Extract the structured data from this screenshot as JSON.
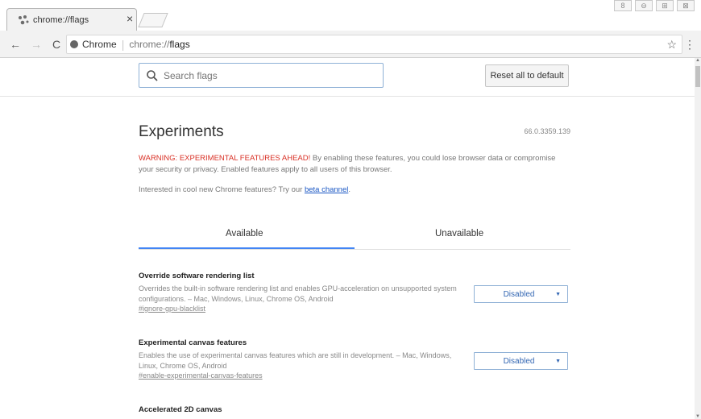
{
  "browser": {
    "tab": {
      "title": "chrome://flags",
      "close": "×"
    },
    "window_controls": [
      "8",
      "⊖",
      "⊞",
      "⊠"
    ],
    "nav": {
      "back": "←",
      "forward": "→",
      "reload": "C"
    },
    "omnibox": {
      "site_label": "Chrome",
      "url_prefix": "chrome://",
      "url_bold": "flags"
    },
    "star": "☆",
    "menu": "⋮"
  },
  "flags_header": {
    "search": {
      "placeholder": "Search flags"
    },
    "reset_label": "Reset all to default"
  },
  "main": {
    "title": "Experiments",
    "version": "66.0.3359.139",
    "warning_red": "WARNING: EXPERIMENTAL FEATURES AHEAD!",
    "warning_rest": " By enabling these features, you could lose browser data or compromise your security or privacy. Enabled features apply to all users of this browser.",
    "interested_text": "Interested in cool new Chrome features? Try our ",
    "interested_link": "beta channel",
    "interested_end": ".",
    "tabs": [
      {
        "label": "Available",
        "selected": true
      },
      {
        "label": "Unavailable",
        "selected": false
      }
    ],
    "flags": [
      {
        "name": "Override software rendering list",
        "description": "Overrides the built-in software rendering list and enables GPU-acceleration on unsupported system configurations. – Mac, Windows, Linux, Chrome OS, Android",
        "link": "#ignore-gpu-blacklist",
        "value": "Disabled"
      },
      {
        "name": "Experimental canvas features",
        "description": "Enables the use of experimental canvas features which are still in development. – Mac, Windows, Linux, Chrome OS, Android",
        "link": "#enable-experimental-canvas-features",
        "value": "Disabled"
      },
      {
        "name": "Accelerated 2D canvas",
        "description": "",
        "link": "",
        "value": ""
      }
    ]
  },
  "colors": {
    "accent": "#4285f4",
    "warning": "#d93025",
    "link": "#1a57c4",
    "select_text": "#3367b3"
  },
  "icons": {
    "tab_favicon": "flags-icon",
    "search": "search-icon",
    "site": "chrome-icon",
    "select_arrow": "dropdown-arrow-icon"
  }
}
